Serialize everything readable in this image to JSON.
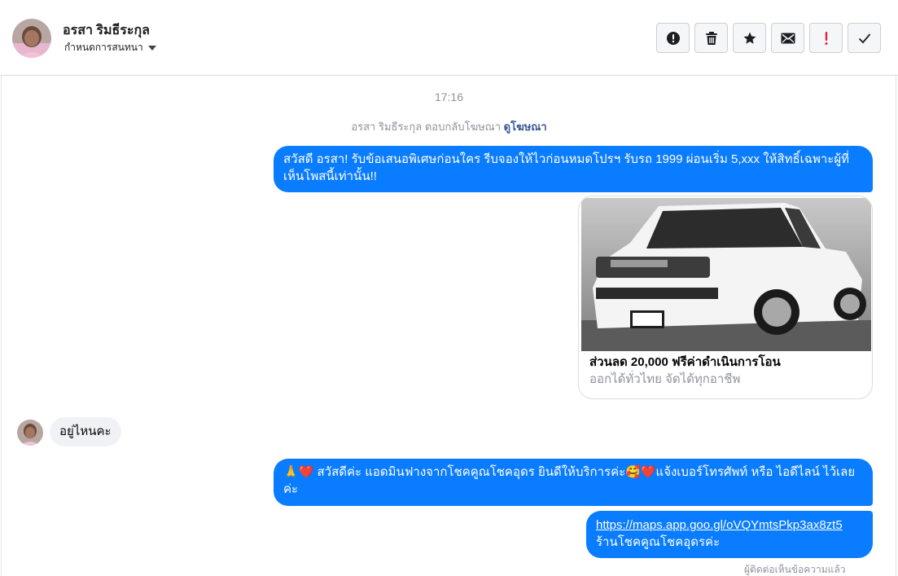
{
  "contact": {
    "name": "อรสา ริมธีระกุล",
    "assign_label": "กำหนดการสนทนา"
  },
  "toolbar": {
    "buttons": [
      {
        "icon": "alert-circle-icon",
        "title": "spam"
      },
      {
        "icon": "trash-icon",
        "title": "delete"
      },
      {
        "icon": "star-icon",
        "title": "follow up"
      },
      {
        "icon": "envelope-icon",
        "title": "mark unread"
      },
      {
        "icon": "exclamation-icon",
        "title": "important"
      },
      {
        "icon": "checkmark-icon",
        "title": "done"
      }
    ]
  },
  "thread": {
    "timestamp": "17:16",
    "reply_note": "อรสา ริมธีระกุล ตอบกลับโฆษณา",
    "reply_link": "ดูโฆษณา",
    "messages": [
      {
        "from": "page",
        "text": "สวัสดี อรสา! รับข้อเสนอพิเศษก่อนใคร รีบจองให้ไวก่อนหมดโปรฯ รับรถ 1999 ผ่อนเริ่ม 5,xxx ให้สิทธิ์เฉพาะผู้ที่เห็นโพสนี้เท่านั้น!!"
      },
      {
        "from": "page",
        "type": "ad_card",
        "title": "ส่วนลด 20,000 ฟรีค่าดำเนินการโอน",
        "subtitle": "ออกได้ทั่วไทย จัดได้ทุกอาชีพ",
        "plate": "ม052",
        "brand": "ISUZU"
      },
      {
        "from": "contact",
        "text": "อยู่ไหนคะ"
      },
      {
        "from": "page",
        "text": "🙏❤️ สวัสดีค่ะ แอดมินฟางจากโชคคูณโชคอุดร ยินดีให้บริการค่ะ🥰❤️แจ้งเบอร์โทรศัพท์ หรือ ไอดีไลน์  ไว้เลยค่ะ"
      },
      {
        "from": "page",
        "link": "https://maps.app.goo.gl/oVQYmtsPkp3ax8zt5",
        "text": "ร้านโชคคูณโชคอุดรค่ะ"
      }
    ],
    "seen_partial": "ผู้ติดต่อเห็นข้อความแล้ว"
  },
  "colors": {
    "outgoing_bubble": "#0a7cff",
    "incoming_bubble": "#f0f2f5",
    "link": "#385898",
    "important": "#e41e3f"
  }
}
